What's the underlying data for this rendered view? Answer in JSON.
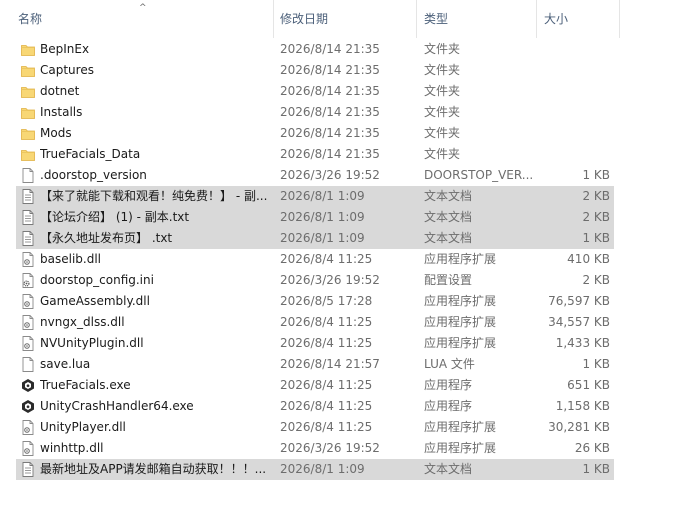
{
  "columns": {
    "name": "名称",
    "date": "修改日期",
    "type": "类型",
    "size": "大小"
  },
  "sort_indicator": "^",
  "files": [
    {
      "name": "BepInEx",
      "date": "2026/8/14 21:35",
      "type": "文件夹",
      "size": "",
      "icon": "folder-icon",
      "selected": false
    },
    {
      "name": "Captures",
      "date": "2026/8/14 21:35",
      "type": "文件夹",
      "size": "",
      "icon": "folder-icon",
      "selected": false
    },
    {
      "name": "dotnet",
      "date": "2026/8/14 21:35",
      "type": "文件夹",
      "size": "",
      "icon": "folder-icon",
      "selected": false
    },
    {
      "name": "Installs",
      "date": "2026/8/14 21:35",
      "type": "文件夹",
      "size": "",
      "icon": "folder-icon",
      "selected": false
    },
    {
      "name": "Mods",
      "date": "2026/8/14 21:35",
      "type": "文件夹",
      "size": "",
      "icon": "folder-icon",
      "selected": false
    },
    {
      "name": "TrueFacials_Data",
      "date": "2026/8/14 21:35",
      "type": "文件夹",
      "size": "",
      "icon": "folder-icon",
      "selected": false
    },
    {
      "name": ".doorstop_version",
      "date": "2026/3/26 19:52",
      "type": "DOORSTOP_VER...",
      "size": "1 KB",
      "icon": "file-icon",
      "selected": false
    },
    {
      "name": "【来了就能下载和观看！纯免费！】 - 副...",
      "date": "2026/8/1 1:09",
      "type": "文本文档",
      "size": "2 KB",
      "icon": "text-file-icon",
      "selected": true
    },
    {
      "name": "【论坛介绍】 (1) - 副本.txt",
      "date": "2026/8/1 1:09",
      "type": "文本文档",
      "size": "2 KB",
      "icon": "text-file-icon",
      "selected": true
    },
    {
      "name": "【永久地址发布页】 .txt",
      "date": "2026/8/1 1:09",
      "type": "文本文档",
      "size": "1 KB",
      "icon": "text-file-icon",
      "selected": true
    },
    {
      "name": "baselib.dll",
      "date": "2026/8/4 11:25",
      "type": "应用程序扩展",
      "size": "410 KB",
      "icon": "dll-icon",
      "selected": false
    },
    {
      "name": "doorstop_config.ini",
      "date": "2026/3/26 19:52",
      "type": "配置设置",
      "size": "2 KB",
      "icon": "config-file-icon",
      "selected": false
    },
    {
      "name": "GameAssembly.dll",
      "date": "2026/8/5 17:28",
      "type": "应用程序扩展",
      "size": "76,597 KB",
      "icon": "dll-icon",
      "selected": false
    },
    {
      "name": "nvngx_dlss.dll",
      "date": "2026/8/4 11:25",
      "type": "应用程序扩展",
      "size": "34,557 KB",
      "icon": "dll-icon",
      "selected": false
    },
    {
      "name": "NVUnityPlugin.dll",
      "date": "2026/8/4 11:25",
      "type": "应用程序扩展",
      "size": "1,433 KB",
      "icon": "dll-icon",
      "selected": false
    },
    {
      "name": "save.lua",
      "date": "2026/8/14 21:57",
      "type": "LUA 文件",
      "size": "1 KB",
      "icon": "file-icon",
      "selected": false
    },
    {
      "name": "TrueFacials.exe",
      "date": "2026/8/4 11:25",
      "type": "应用程序",
      "size": "651 KB",
      "icon": "unity-exe-icon",
      "selected": false
    },
    {
      "name": "UnityCrashHandler64.exe",
      "date": "2026/8/4 11:25",
      "type": "应用程序",
      "size": "1,158 KB",
      "icon": "unity-exe-icon",
      "selected": false
    },
    {
      "name": "UnityPlayer.dll",
      "date": "2026/8/4 11:25",
      "type": "应用程序扩展",
      "size": "30,281 KB",
      "icon": "dll-icon",
      "selected": false
    },
    {
      "name": "winhttp.dll",
      "date": "2026/3/26 19:52",
      "type": "应用程序扩展",
      "size": "26 KB",
      "icon": "dll-icon",
      "selected": false
    },
    {
      "name": "最新地址及APP请发邮箱自动获取！！！...",
      "date": "2026/8/1 1:09",
      "type": "文本文档",
      "size": "1 KB",
      "icon": "text-file-icon",
      "selected": true
    }
  ]
}
